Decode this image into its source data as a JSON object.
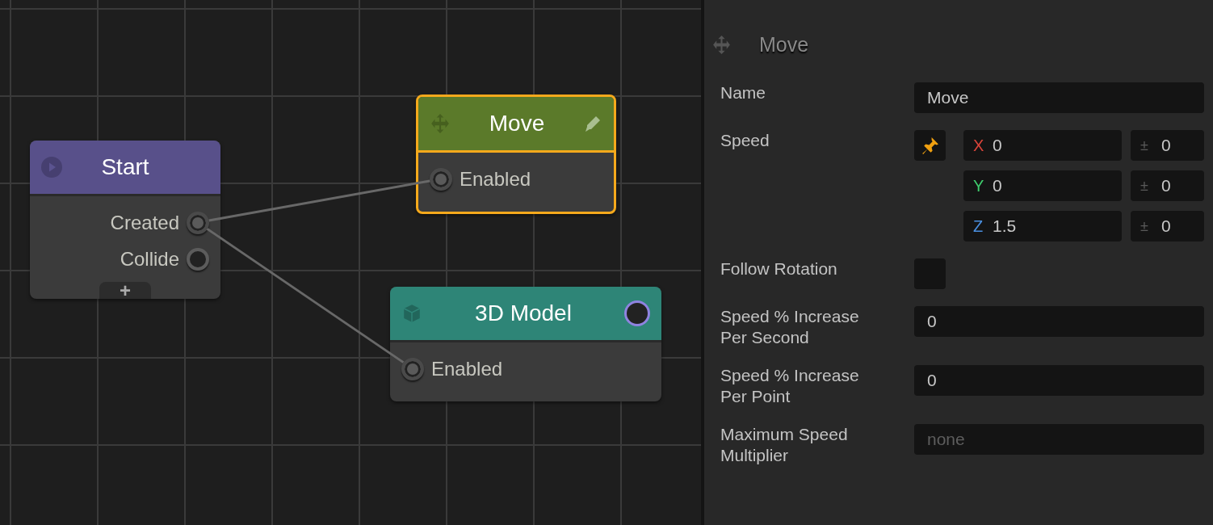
{
  "canvas": {
    "nodes": [
      {
        "kind": "event",
        "title": "Start",
        "color": "#58508a",
        "selected": false,
        "outputs": [
          {
            "label": "Created",
            "connected": true
          },
          {
            "label": "Collide",
            "connected": false
          }
        ],
        "add_button": "+"
      },
      {
        "kind": "action",
        "title": "Move",
        "color": "#5b7a2a",
        "selected": true,
        "editable": true,
        "inputs": [
          {
            "label": "Enabled",
            "connected": true
          }
        ]
      },
      {
        "kind": "component",
        "title": "3D Model",
        "color": "#2e8577",
        "selected": false,
        "header_output": true,
        "inputs": [
          {
            "label": "Enabled",
            "connected": true
          }
        ]
      }
    ]
  },
  "inspector": {
    "title": "Move",
    "properties": [
      {
        "kind": "text",
        "label": "Name",
        "value": "Move"
      },
      {
        "kind": "vector",
        "label": "Speed",
        "pinned": true,
        "axes": [
          {
            "axis": "X",
            "color": "#d9443a",
            "value": "0",
            "variance_sign": "±",
            "variance": "0"
          },
          {
            "axis": "Y",
            "color": "#3fcf6e",
            "value": "0",
            "variance_sign": "±",
            "variance": "0"
          },
          {
            "axis": "Z",
            "color": "#4a8fe0",
            "value": "1.5",
            "variance_sign": "±",
            "variance": "0"
          }
        ]
      },
      {
        "kind": "checkbox",
        "label": "Follow Rotation",
        "checked": false
      },
      {
        "kind": "text",
        "label": "Speed % Increase Per Second",
        "value": "0"
      },
      {
        "kind": "text",
        "label": "Speed % Increase Per Point",
        "value": "0"
      },
      {
        "kind": "text",
        "label": "Maximum Speed Multiplier",
        "placeholder": "none"
      }
    ]
  }
}
